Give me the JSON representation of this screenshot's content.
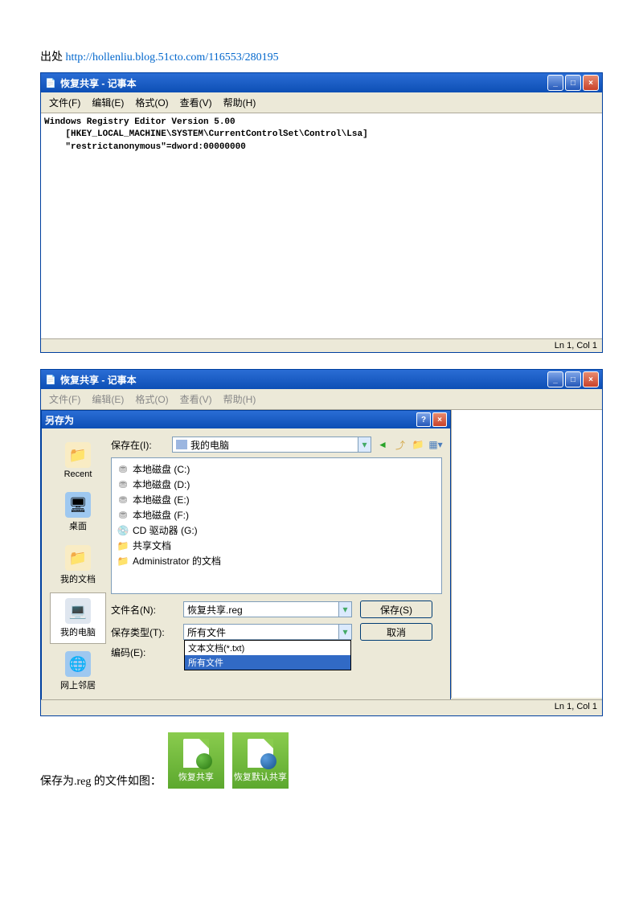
{
  "source": {
    "prefix": "出处 ",
    "url": "http://hollenliu.blog.51cto.com/116553/280195"
  },
  "notepad1": {
    "title": "恢复共享 - 记事本",
    "menus": [
      "文件(F)",
      "编辑(E)",
      "格式(O)",
      "查看(V)",
      "帮助(H)"
    ],
    "content": "Windows Registry Editor Version 5.00\n    [HKEY_LOCAL_MACHINE\\SYSTEM\\CurrentControlSet\\Control\\Lsa]\n    \"restrictanonymous\"=dword:00000000",
    "status": "Ln 1, Col 1"
  },
  "notepad2": {
    "title": "恢复共享 - 记事本",
    "menus": [
      "文件(F)",
      "编辑(E)",
      "格式(O)",
      "查看(V)",
      "帮助(H)"
    ],
    "status": "Ln 1, Col 1"
  },
  "saveas": {
    "title": "另存为",
    "loc_label": "保存在(I):",
    "loc_value": "我的电脑",
    "sidebar": [
      {
        "label": "Recent"
      },
      {
        "label": "桌面"
      },
      {
        "label": "我的文档"
      },
      {
        "label": "我的电脑",
        "selected": true
      },
      {
        "label": "网上邻居"
      }
    ],
    "files": [
      {
        "type": "disk",
        "label": "本地磁盘 (C:)"
      },
      {
        "type": "disk",
        "label": "本地磁盘 (D:)"
      },
      {
        "type": "disk",
        "label": "本地磁盘 (E:)"
      },
      {
        "type": "disk",
        "label": "本地磁盘 (F:)"
      },
      {
        "type": "cd",
        "label": "CD 驱动器 (G:)"
      },
      {
        "type": "folder",
        "label": "共享文档"
      },
      {
        "type": "folder",
        "label": "Administrator 的文档"
      }
    ],
    "filename_label": "文件名(N):",
    "filename_value": "恢复共享.reg",
    "filetype_label": "保存类型(T):",
    "filetype_value": "所有文件",
    "filetype_options": [
      "文本文档(*.txt)",
      "所有文件"
    ],
    "encoding_label": "编码(E):",
    "save_btn": "保存(S)",
    "cancel_btn": "取消"
  },
  "reg_line": {
    "text": "保存为.reg 的文件如图：",
    "icons": [
      "恢复共享",
      "恢复默认共享"
    ]
  }
}
